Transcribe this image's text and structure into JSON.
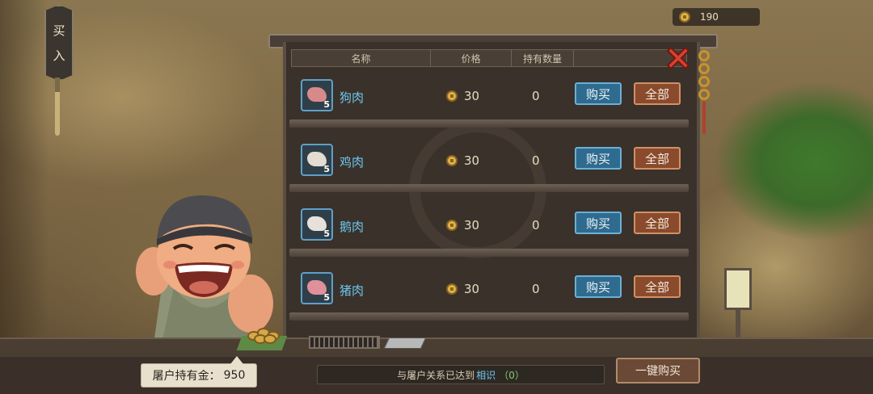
{
  "sign": {
    "char1": "买",
    "char2": "入"
  },
  "player_gold": "190",
  "table": {
    "headers": [
      "名称",
      "价格",
      "持有数量",
      ""
    ],
    "rows": [
      {
        "name": "狗肉",
        "count": "5",
        "price": "30",
        "held": "0",
        "buy": "购买",
        "all": "全部",
        "meat_color": "#d88a8a"
      },
      {
        "name": "鸡肉",
        "count": "5",
        "price": "30",
        "held": "0",
        "buy": "购买",
        "all": "全部",
        "meat_color": "#e2dcd2"
      },
      {
        "name": "鹅肉",
        "count": "5",
        "price": "30",
        "held": "0",
        "buy": "购买",
        "all": "全部",
        "meat_color": "#e6e2da"
      },
      {
        "name": "猪肉",
        "count": "5",
        "price": "30",
        "held": "0",
        "buy": "购买",
        "all": "全部",
        "meat_color": "#e0909a"
      }
    ]
  },
  "footer": {
    "butcher_gold_label": "屠户持有金：",
    "butcher_gold": "950",
    "relation_text": "与屠户关系已达到",
    "relation_level": "相识",
    "relation_value": "（0）",
    "one_key_buy": "一键购买"
  },
  "colors": {
    "buy_button": "#2f6b8f",
    "all_button": "#8a4a2c",
    "item_name": "#6cc6ef"
  }
}
